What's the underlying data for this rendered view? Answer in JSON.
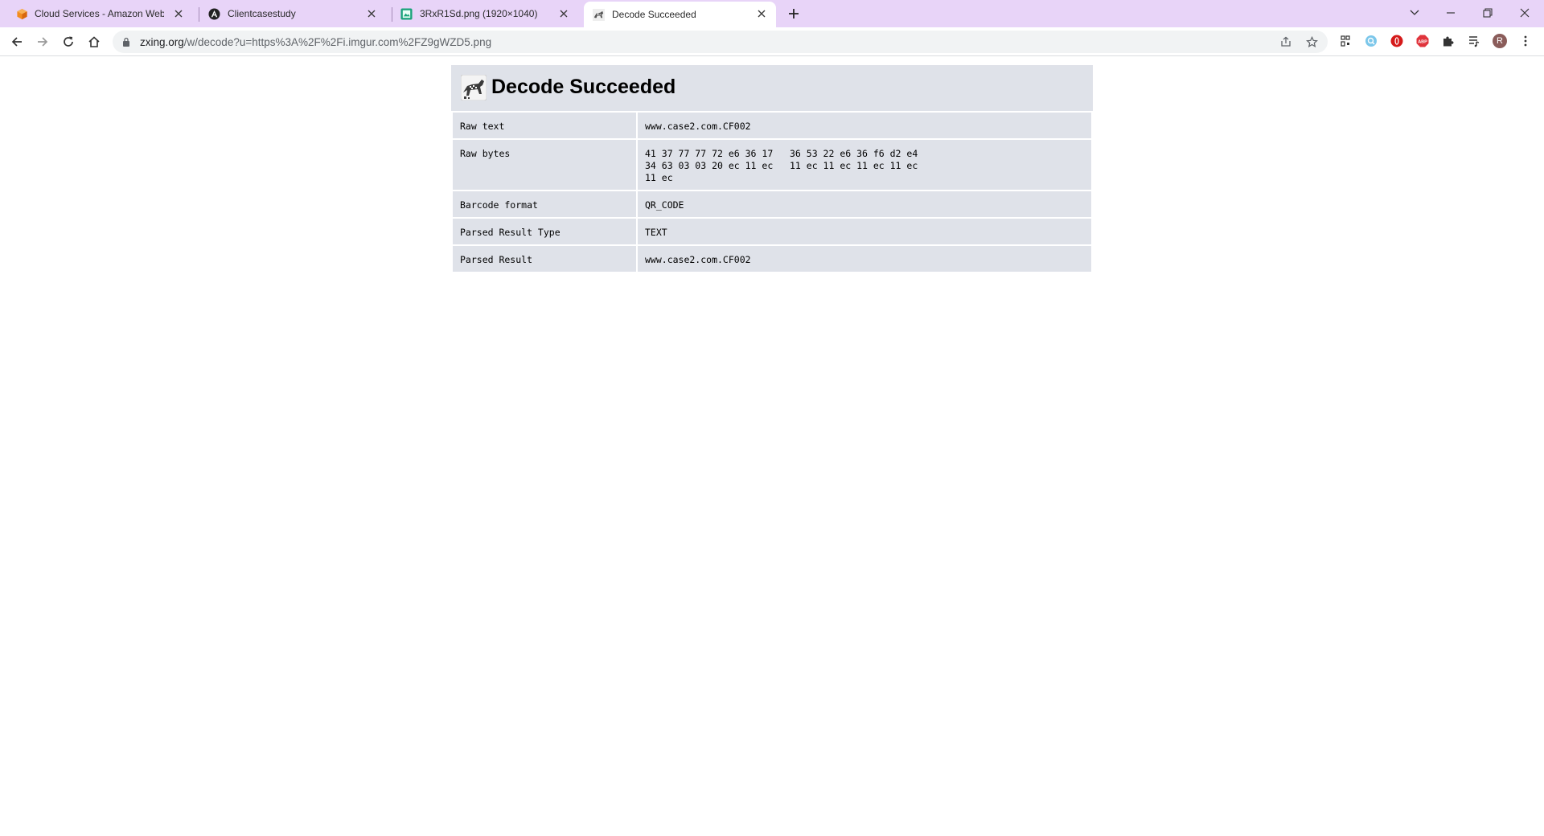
{
  "browser": {
    "tabs": [
      {
        "title": "Cloud Services - Amazon Web Se",
        "favicon": "aws-icon",
        "active": false
      },
      {
        "title": "Clientcasestudy",
        "favicon": "angular-icon",
        "active": false
      },
      {
        "title": "3RxR1Sd.png (1920×1040)",
        "favicon": "image-icon",
        "active": false
      },
      {
        "title": "Decode Succeeded",
        "favicon": "zxing-icon",
        "active": true
      }
    ],
    "address": {
      "host": "zxing.org",
      "path": "/w/decode?u=https%3A%2F%2Fi.imgur.com%2FZ9gWZD5.png"
    },
    "profile_initial": "R"
  },
  "page": {
    "title": "Decode Succeeded",
    "rows": [
      {
        "label": "Raw text",
        "value": "www.case2.com.CF002"
      },
      {
        "label": "Raw bytes",
        "value": "41 37 77 77 72 e6 36 17   36 53 22 e6 36 f6 d2 e4\n34 63 03 03 20 ec 11 ec   11 ec 11 ec 11 ec 11 ec\n11 ec"
      },
      {
        "label": "Barcode format",
        "value": "QR_CODE"
      },
      {
        "label": "Parsed Result Type",
        "value": "TEXT"
      },
      {
        "label": "Parsed Result",
        "value": "www.case2.com.CF002"
      }
    ]
  },
  "colors": {
    "tabstrip": "#e8d4f8",
    "panel": "#dfe2e9",
    "omnibox": "#f1f3f4"
  }
}
